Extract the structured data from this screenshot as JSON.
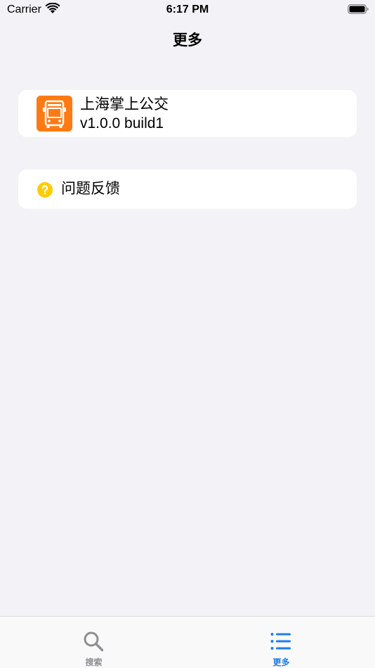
{
  "status_bar": {
    "carrier": "Carrier",
    "time": "6:17 PM"
  },
  "nav": {
    "title": "更多"
  },
  "app_info": {
    "name": "上海掌上公交",
    "version": "v1.0.0 build1",
    "icon": "bus-icon",
    "icon_color": "#ff7a12"
  },
  "feedback": {
    "label": "问题反馈",
    "icon": "question-icon",
    "icon_color": "#ffcc00"
  },
  "tab_bar": {
    "tabs": [
      {
        "label": "搜索",
        "icon": "search-icon",
        "selected": false
      },
      {
        "label": "更多",
        "icon": "list-icon",
        "selected": true
      }
    ],
    "active_color": "#1e7df0",
    "inactive_color": "#8e8e93"
  }
}
